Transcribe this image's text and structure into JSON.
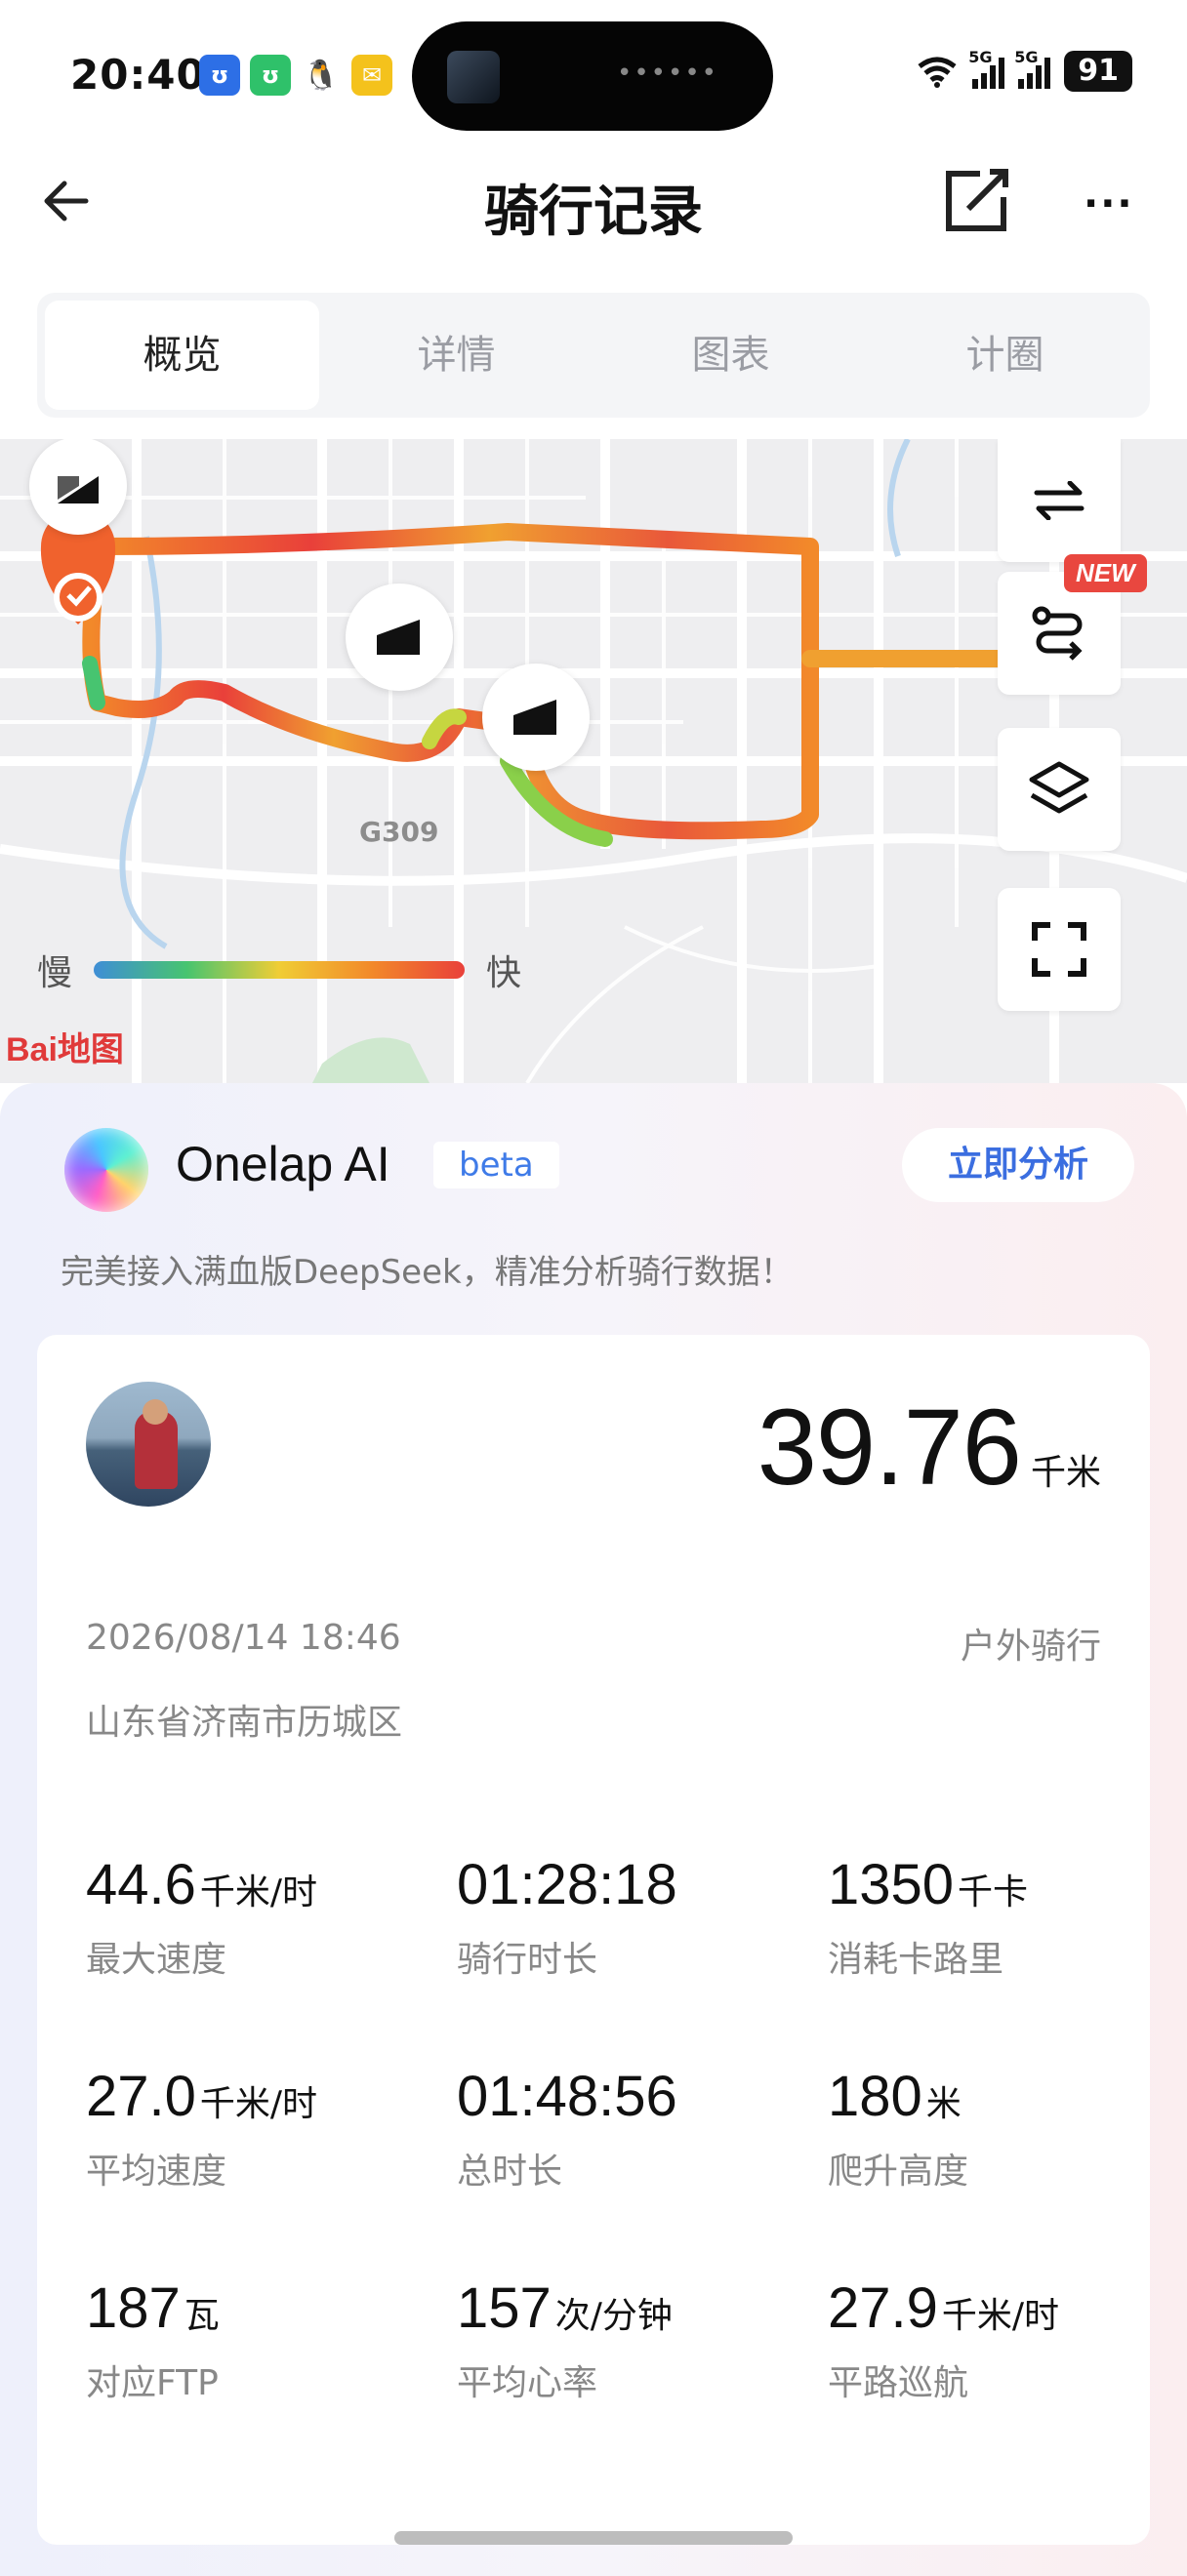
{
  "status_bar": {
    "time": "20:40",
    "battery": "91",
    "network_1": "5G",
    "network_2": "5G",
    "wifi_sub": "7"
  },
  "header": {
    "title": "骑行记录"
  },
  "tabs": [
    {
      "label": "概览",
      "active": true
    },
    {
      "label": "详情",
      "active": false
    },
    {
      "label": "图表",
      "active": false
    },
    {
      "label": "计圈",
      "active": false
    }
  ],
  "map": {
    "road_label": "G309",
    "legend_slow": "慢",
    "legend_fast": "快",
    "logo_text": "Bai地图",
    "new_badge": "NEW",
    "colors": {
      "slow": "#3f8ed6",
      "fast": "#e9403a",
      "start_marker": "#f0622d"
    }
  },
  "ai": {
    "title": "Onelap AI",
    "badge": "beta",
    "button": "立即分析",
    "subtitle": "完美接入满血版DeepSeek，精准分析骑行数据！"
  },
  "summary": {
    "distance": "39.76",
    "distance_unit": "千米",
    "date": "2026/08/14 18:46",
    "type": "户外骑行",
    "location": "山东省济南市历城区"
  },
  "stats": [
    {
      "value": "44.6",
      "unit": "千米/时",
      "label": "最大速度"
    },
    {
      "value": "01:28:18",
      "unit": "",
      "label": "骑行时长"
    },
    {
      "value": "1350",
      "unit": "千卡",
      "label": "消耗卡路里"
    },
    {
      "value": "27.0",
      "unit": "千米/时",
      "label": "平均速度"
    },
    {
      "value": "01:48:56",
      "unit": "",
      "label": "总时长"
    },
    {
      "value": "180",
      "unit": "米",
      "label": "爬升高度"
    },
    {
      "value": "187",
      "unit": "瓦",
      "label": "对应FTP"
    },
    {
      "value": "157",
      "unit": "次/分钟",
      "label": "平均心率"
    },
    {
      "value": "27.9",
      "unit": "千米/时",
      "label": "平路巡航"
    }
  ]
}
